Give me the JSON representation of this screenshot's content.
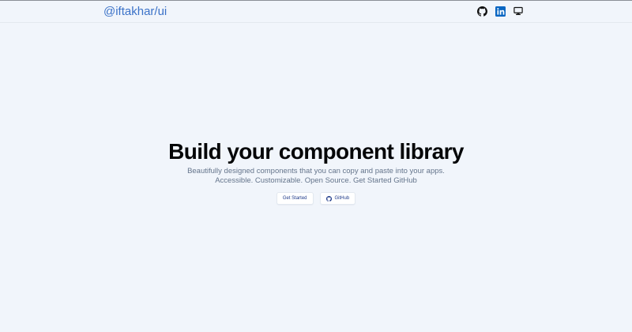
{
  "header": {
    "brand": "@iftakhar/ui",
    "icons": [
      "github-icon",
      "linkedin-icon",
      "monitor-icon"
    ]
  },
  "hero": {
    "title": "Build your component library",
    "subtitle_line1": "Beautifully designed components that you can copy and paste into your apps.",
    "subtitle_line2": "Accessible. Customizable. Open Source. Get Started GitHub",
    "primary_button": "Get Started",
    "secondary_button": "GitHub"
  },
  "colors": {
    "background": "#f1f5fb",
    "brand": "#3b72c8",
    "linkedin": "#0a66c2",
    "title": "#050608",
    "muted": "#64748b",
    "button_text": "#1e3a8a"
  }
}
